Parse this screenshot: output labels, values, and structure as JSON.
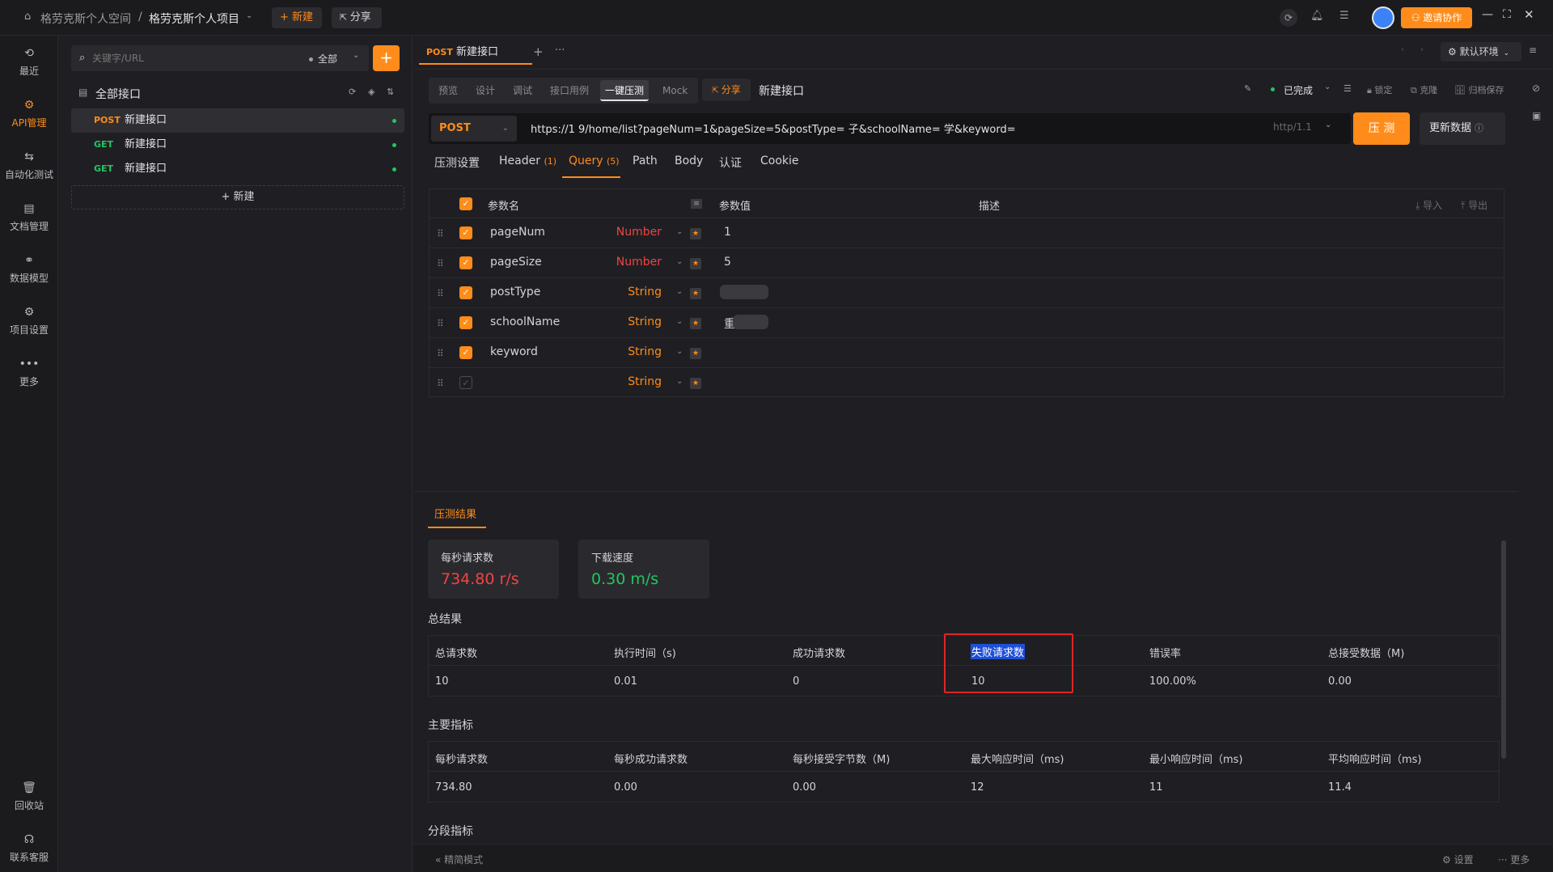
{
  "titlebar": {
    "workspace": "格劳克斯个人空间",
    "separator": "/",
    "project": "格劳克斯个人项目",
    "new_label": "新建",
    "share_label": "分享",
    "invite_label": "邀请协作"
  },
  "rail": {
    "items": [
      {
        "label": "最近",
        "icon": "history-icon"
      },
      {
        "label": "API管理",
        "icon": "api-icon"
      },
      {
        "label": "自动化测试",
        "icon": "automation-icon"
      },
      {
        "label": "文档管理",
        "icon": "document-icon"
      },
      {
        "label": "数据模型",
        "icon": "data-model-icon"
      },
      {
        "label": "项目设置",
        "icon": "settings-icon"
      },
      {
        "label": "更多",
        "icon": "more-icon"
      }
    ],
    "bottom": [
      {
        "label": "回收站",
        "icon": "trash-icon"
      },
      {
        "label": "联系客服",
        "icon": "headset-icon"
      }
    ]
  },
  "sidebar": {
    "search_placeholder": "关键字/URL",
    "filter_label": "全部",
    "tree_root": "全部接口",
    "apis": [
      {
        "method": "POST",
        "name": "新建接口"
      },
      {
        "method": "GET",
        "name": "新建接口"
      },
      {
        "method": "GET",
        "name": "新建接口"
      }
    ],
    "new_label": "新建"
  },
  "tabbar": {
    "tab_method": "POST",
    "tab_name": "新建接口",
    "env_label": "默认环境"
  },
  "mode_tabs": [
    "预览",
    "设计",
    "调试",
    "接口用例",
    "一键压测",
    "Mock"
  ],
  "mode_share": "分享",
  "api_name": "新建接口",
  "status": {
    "done": "已完成",
    "lock": "锁定",
    "clone": "克隆",
    "archive": "归档保存"
  },
  "request": {
    "method": "POST",
    "url": "https://1          9/home/list?pageNum=1&pageSize=5&postType=          子&schoolName=          学&keyword=",
    "protocol": "http/1.1",
    "send_label": "压 测",
    "update_label": "更新数据"
  },
  "sub_tabs": [
    {
      "label": "压测设置",
      "count": ""
    },
    {
      "label": "Header",
      "count": "(1)"
    },
    {
      "label": "Query",
      "count": "(5)"
    },
    {
      "label": "Path",
      "count": ""
    },
    {
      "label": "Body",
      "count": ""
    },
    {
      "label": "认证",
      "count": ""
    },
    {
      "label": "Cookie",
      "count": ""
    }
  ],
  "params_table": {
    "col_name": "参数名",
    "col_value": "参数值",
    "col_desc": "描述",
    "import_label": "导入",
    "export_label": "导出",
    "rows": [
      {
        "name": "pageNum",
        "type": "Number",
        "value": "1",
        "checked": true
      },
      {
        "name": "pageSize",
        "type": "Number",
        "value": "5",
        "checked": true
      },
      {
        "name": "postType",
        "type": "String",
        "value": "",
        "checked": true
      },
      {
        "name": "schoolName",
        "type": "String",
        "value": "重",
        "checked": true
      },
      {
        "name": "keyword",
        "type": "String",
        "value": "",
        "checked": true
      },
      {
        "name": "",
        "type": "String",
        "value": "",
        "checked": false
      }
    ]
  },
  "results": {
    "tab_label": "压测结果",
    "cards": [
      {
        "label": "每秒请求数",
        "value": "734.80 r/s",
        "color": "#ef4444"
      },
      {
        "label": "下载速度",
        "value": "0.30 m/s",
        "color": "#22c55e"
      }
    ],
    "summary_title": "总结果",
    "summary_headers": [
      "总请求数",
      "执行时间（s)",
      "成功请求数",
      "失败请求数",
      "错误率",
      "总接受数据（M)"
    ],
    "summary_values": [
      "10",
      "0.01",
      "0",
      "10",
      "100.00%",
      "0.00"
    ],
    "main_title": "主要指标",
    "main_headers": [
      "每秒请求数",
      "每秒成功请求数",
      "每秒接受字节数（M)",
      "最大响应时间（ms)",
      "最小响应时间（ms)",
      "平均响应时间（ms)"
    ],
    "main_values": [
      "734.80",
      "0.00",
      "0.00",
      "12",
      "11",
      "11.4"
    ],
    "segment_title": "分段指标"
  },
  "footer": {
    "mode_label": "精简模式",
    "settings_label": "设置",
    "more_label": "更多"
  }
}
